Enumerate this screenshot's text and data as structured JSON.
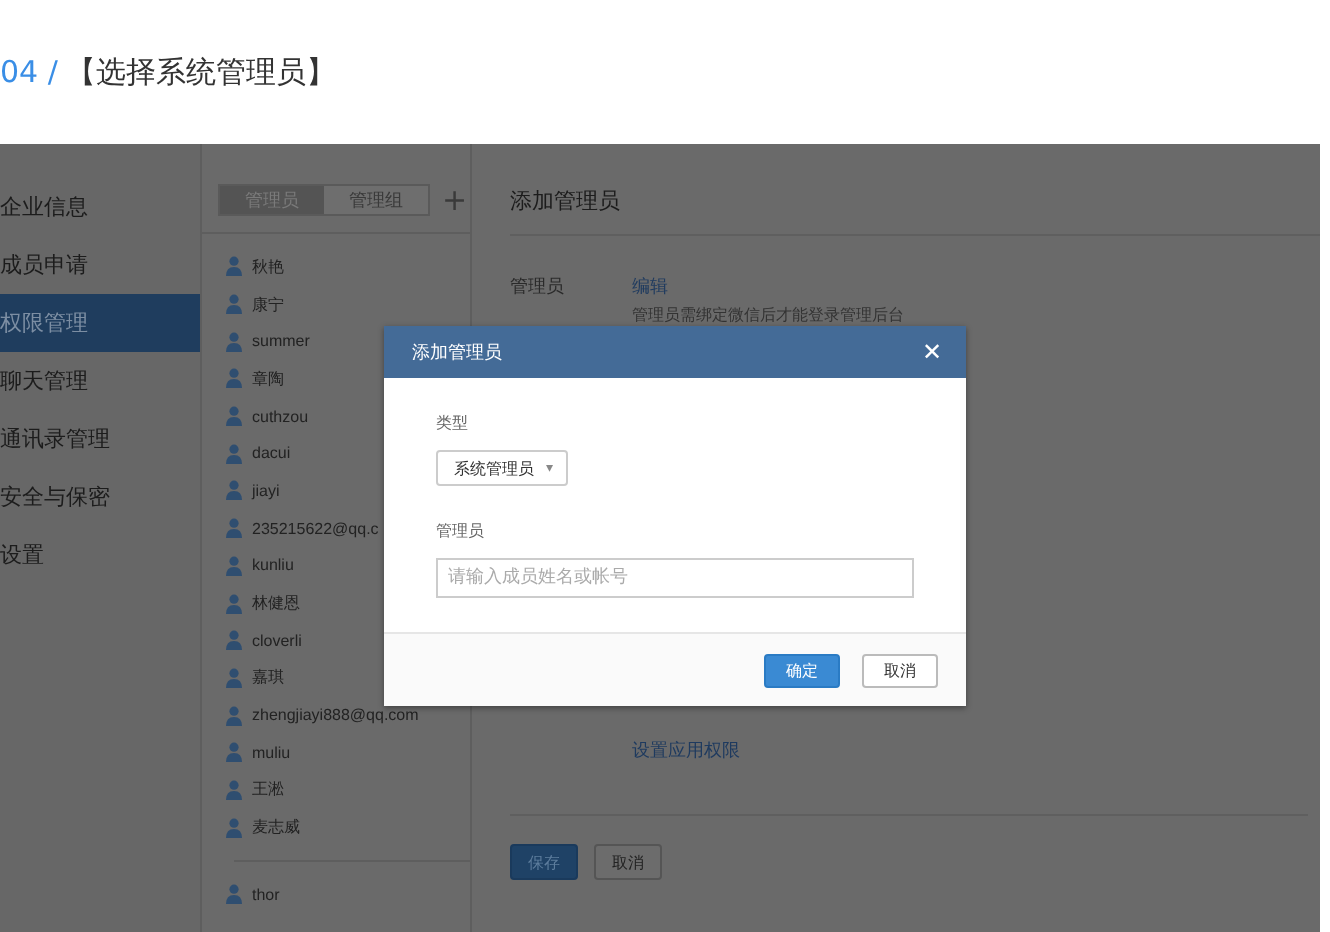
{
  "header": {
    "step": "04 /",
    "title": "【选择系统管理员】"
  },
  "sidebar": {
    "items": [
      {
        "label": "企业信息",
        "selected": false
      },
      {
        "label": "成员申请",
        "selected": false
      },
      {
        "label": "权限管理",
        "selected": true
      },
      {
        "label": "聊天管理",
        "selected": false
      },
      {
        "label": "通讯录管理",
        "selected": false
      },
      {
        "label": "安全与保密",
        "selected": false
      },
      {
        "label": "设置",
        "selected": false
      }
    ]
  },
  "member_tabs": [
    {
      "label": "管理员",
      "selected": true
    },
    {
      "label": "管理组",
      "selected": false
    }
  ],
  "add_button": "+",
  "members": [
    {
      "name": "秋艳"
    },
    {
      "name": "康宁"
    },
    {
      "name": "summer"
    },
    {
      "name": "章陶"
    },
    {
      "name": "cuthzou"
    },
    {
      "name": "dacui"
    },
    {
      "name": "jiayi"
    },
    {
      "name": "235215622@qq.c"
    },
    {
      "name": "kunliu"
    },
    {
      "name": "林健恩"
    },
    {
      "name": "cloverli"
    },
    {
      "name": "嘉琪"
    },
    {
      "name": "zhengjiayi888@qq.com"
    },
    {
      "name": "muliu"
    },
    {
      "name": "王淞"
    },
    {
      "name": "麦志威"
    }
  ],
  "other_members": [
    {
      "name": "thor"
    }
  ],
  "content": {
    "title": "添加管理员",
    "field_label": "管理员",
    "edit_link": "编辑",
    "note": "管理员需绑定微信后才能登录管理后台",
    "permissions_link": "设置应用权限",
    "buttons": [
      {
        "label": "保存",
        "kind": "primary"
      },
      {
        "label": "取消",
        "kind": "secondary"
      }
    ]
  },
  "dialog": {
    "title": "添加管理员",
    "close": "✕",
    "type_label": "类型",
    "type_value": "系统管理员",
    "type_caret": "▾",
    "admin_label": "管理员",
    "admin_placeholder": "请输入成员姓名或帐号",
    "buttons": [
      {
        "label": "确定",
        "kind": "primary"
      },
      {
        "label": "取消",
        "kind": "secondary"
      }
    ]
  }
}
